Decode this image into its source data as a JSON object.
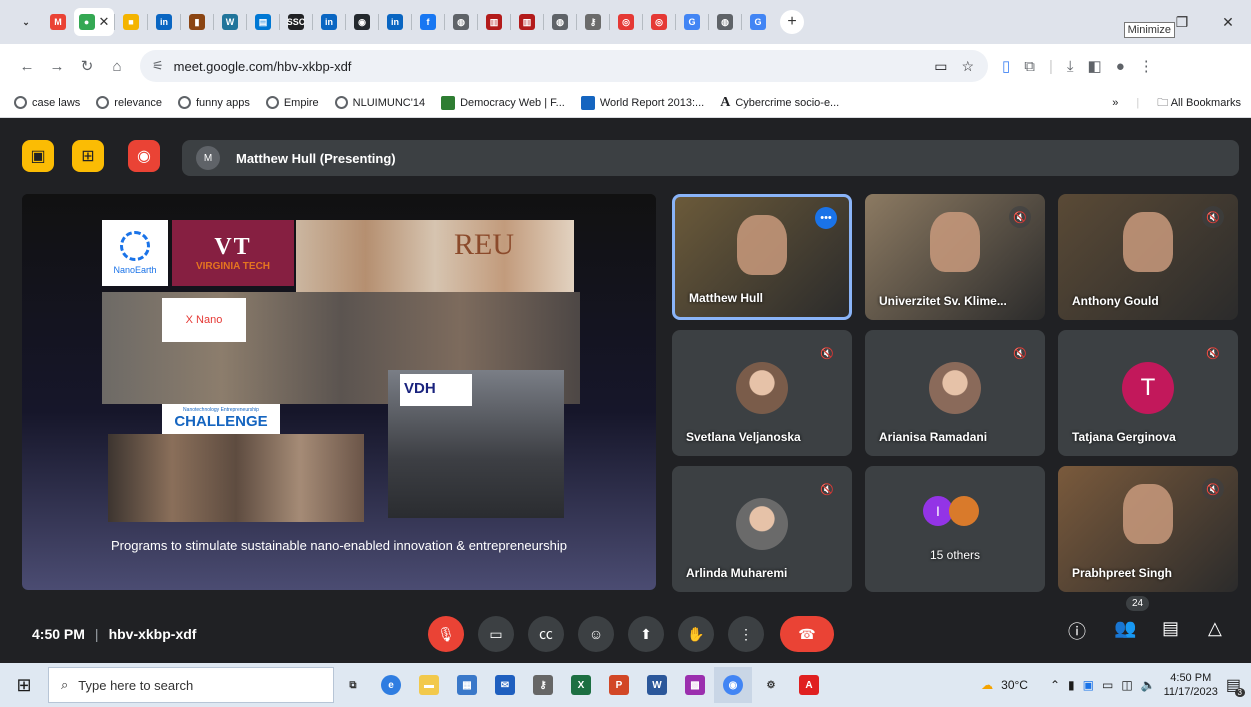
{
  "browser": {
    "tabs": [
      {
        "icon": "chevron-down",
        "color": "#5f6368",
        "glyph": "⌄"
      },
      {
        "icon": "gmail",
        "color": "#ea4335",
        "glyph": "M"
      },
      {
        "icon": "meet",
        "color": "#34a853",
        "glyph": "●",
        "active": true
      },
      {
        "icon": "docs",
        "color": "#f4b400",
        "glyph": "■"
      },
      {
        "icon": "linkedin",
        "color": "#0a66c2",
        "glyph": "in"
      },
      {
        "icon": "bookmark",
        "color": "#8b4513",
        "glyph": "▮"
      },
      {
        "icon": "wordpress",
        "color": "#21759b",
        "glyph": "W"
      },
      {
        "icon": "outlook",
        "color": "#0078d4",
        "glyph": "▤"
      },
      {
        "icon": "ssc",
        "color": "#202124",
        "glyph": "SSC"
      },
      {
        "icon": "linkedin",
        "color": "#0a66c2",
        "glyph": "in"
      },
      {
        "icon": "github",
        "color": "#24292e",
        "glyph": "◉"
      },
      {
        "icon": "linkedin",
        "color": "#0a66c2",
        "glyph": "in"
      },
      {
        "icon": "facebook",
        "color": "#1877f2",
        "glyph": "f"
      },
      {
        "icon": "globe",
        "color": "#5f6368",
        "glyph": "◍"
      },
      {
        "icon": "library",
        "color": "#b31b1b",
        "glyph": "▥"
      },
      {
        "icon": "library",
        "color": "#b31b1b",
        "glyph": "▥"
      },
      {
        "icon": "globe",
        "color": "#5f6368",
        "glyph": "◍"
      },
      {
        "icon": "key",
        "color": "#6b6b6b",
        "glyph": "⚷"
      },
      {
        "icon": "target",
        "color": "#e53935",
        "glyph": "◎"
      },
      {
        "icon": "target",
        "color": "#e53935",
        "glyph": "◎"
      },
      {
        "icon": "google",
        "color": "#4285f4",
        "glyph": "G"
      },
      {
        "icon": "globe",
        "color": "#5f6368",
        "glyph": "◍"
      },
      {
        "icon": "google",
        "color": "#4285f4",
        "glyph": "G"
      }
    ],
    "tooltip": "Minimize",
    "url": "meet.google.com/hbv-xkbp-xdf",
    "bookmarks": [
      {
        "label": "case laws",
        "icon": "globe"
      },
      {
        "label": "relevance",
        "icon": "globe"
      },
      {
        "label": "funny apps",
        "icon": "globe"
      },
      {
        "label": "Empire",
        "icon": "globe"
      },
      {
        "label": "NLUIMUNC'14",
        "icon": "globe"
      },
      {
        "label": "Democracy Web | F...",
        "icon": "democracy",
        "color": "#2e7d32"
      },
      {
        "label": "World Report 2013:...",
        "icon": "report",
        "color": "#1565c0"
      },
      {
        "label": "Cybercrime socio-e...",
        "icon": "a-letter",
        "color": "#202124"
      }
    ],
    "more_label": "»",
    "all_bookmarks": "All Bookmarks"
  },
  "meet": {
    "presenter_initial": "M",
    "presenter_label": "Matthew Hull (Presenting)",
    "slide": {
      "caption": "Programs to stimulate sustainable nano-enabled innovation & entrepreneurship",
      "logo_nanoearth": "NanoEarth",
      "logo_vt": "VT",
      "logo_vt_name": "VIRGINIA TECH",
      "reu": "REU",
      "vdh": "VDH",
      "xnano": "X Nano",
      "challenge_top": "Nanotechnology Entrepreneurship",
      "challenge": "CHALLENGE"
    },
    "participants": [
      {
        "name": "Matthew Hull",
        "type": "video",
        "bg": "#6b5a3a",
        "speaking": true
      },
      {
        "name": "Univerzitet Sv. Klime...",
        "type": "video",
        "bg": "#8c7a62"
      },
      {
        "name": "Anthony Gould",
        "type": "video",
        "bg": "#5a4a36"
      },
      {
        "name": "Svetlana Veljanoska",
        "type": "avatar",
        "avatar_color": "#7a5c4a"
      },
      {
        "name": "Arianisa Ramadani",
        "type": "avatar",
        "avatar_color": "#8a6a5a"
      },
      {
        "name": "Tatjana Gerginova",
        "type": "initial",
        "initial": "T",
        "avatar_color": "#c2185b"
      },
      {
        "name": "Arlinda Muharemi",
        "type": "avatar",
        "avatar_color": "#6a6a6a"
      },
      {
        "name": "15 others",
        "type": "group",
        "initial": "I",
        "avatar_color": "#9334e6"
      },
      {
        "name": "Prabhpreet Singh",
        "type": "video",
        "bg": "#7a5a3c"
      }
    ],
    "time": "4:50 PM",
    "meeting_code": "hbv-xkbp-xdf",
    "people_count": "24"
  },
  "taskbar": {
    "search_placeholder": "Type here to search",
    "weather": "30°C",
    "time": "4:50 PM",
    "date": "11/17/2023",
    "notifications": "3"
  }
}
